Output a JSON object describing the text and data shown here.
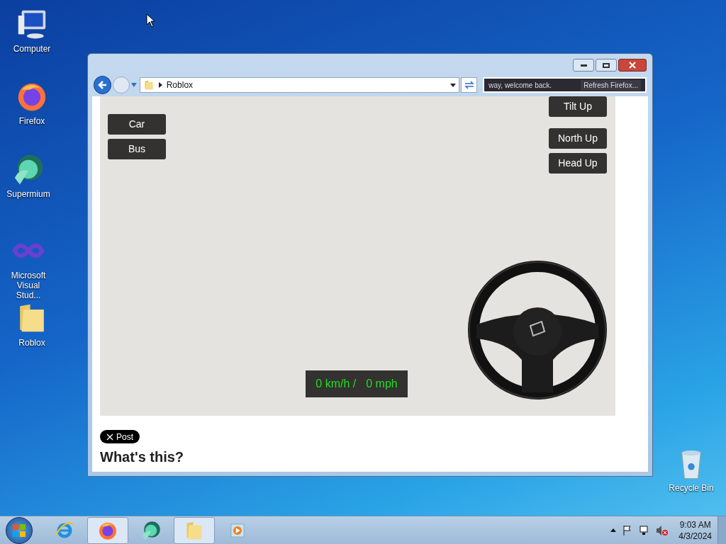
{
  "desktop_icons": [
    {
      "label": "Computer",
      "kind": "computer"
    },
    {
      "label": "Firefox",
      "kind": "firefox"
    },
    {
      "label": "Supermium",
      "kind": "supermium"
    },
    {
      "label": "Microsoft Visual Stud...",
      "kind": "vs"
    },
    {
      "label": "Roblox",
      "kind": "folder"
    },
    {
      "label": "Recycle Bin",
      "kind": "bin"
    }
  ],
  "window": {
    "address": "Roblox",
    "notification": {
      "message": "way, welcome back.",
      "button": "Refresh Firefox..."
    }
  },
  "map": {
    "vehicle_buttons": [
      "Car",
      "Bus"
    ],
    "view_buttons": [
      "Tilt Up",
      "North Up",
      "Head Up"
    ],
    "speed_kmh": "0 km/h /",
    "speed_mph": "0 mph"
  },
  "post_button": "Post",
  "heading": "What's this?",
  "taskbar": {
    "apps": [
      {
        "kind": "ie",
        "selected": false
      },
      {
        "kind": "firefox",
        "selected": true
      },
      {
        "kind": "supermium",
        "selected": false
      },
      {
        "kind": "explorer",
        "selected": true
      },
      {
        "kind": "media",
        "selected": false
      }
    ],
    "time": "9:03 AM",
    "date": "4/3/2024"
  }
}
